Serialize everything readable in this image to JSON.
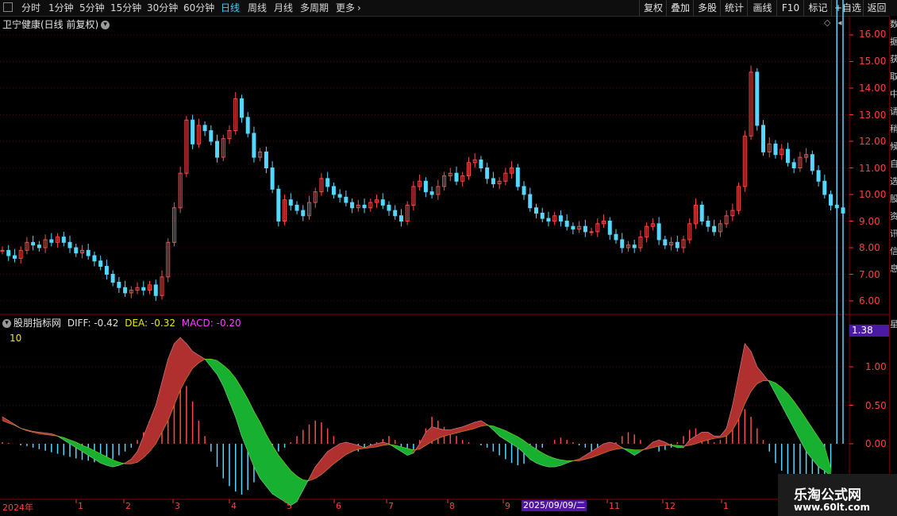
{
  "toolbar": {
    "periods": [
      "分时",
      "1分钟",
      "5分钟",
      "15分钟",
      "30分钟",
      "60分钟",
      "日线",
      "周线",
      "月线",
      "多周期",
      "更多"
    ],
    "active": "日线",
    "right_buttons": [
      "复权",
      "叠加",
      "多股",
      "统计",
      "画线",
      "F10",
      "标记",
      "+自选",
      "返回"
    ]
  },
  "main_chart": {
    "title": "卫宁健康(日线 前复权)",
    "yaxis": [
      "16.00",
      "15.00",
      "14.00",
      "13.00",
      "12.00",
      "11.00",
      "10.00",
      "9.00",
      "8.00",
      "7.00",
      "6.00"
    ]
  },
  "indicator": {
    "name": "股朋指标网",
    "diff": "DIFF: -0.42",
    "dea": "DEA: -0.32",
    "macd": "MACD: -0.20",
    "param": "10",
    "current_value": "1.38",
    "yaxis": [
      "1.00",
      "0.50",
      "0.00"
    ],
    "colors": {
      "diff": "#e0e0e0",
      "dea": "#e8e800",
      "macd": "#ff40ff"
    }
  },
  "xaxis": {
    "labels": [
      "2024年",
      "1",
      "2",
      "3",
      "4",
      "5",
      "6",
      "7",
      "8",
      "9",
      "10",
      "11",
      "12",
      "1"
    ],
    "cursor_date": "2025/09/09/二"
  },
  "right_panel": {
    "chars": [
      "数",
      "据",
      "获",
      "取",
      "中",
      "请",
      "稍",
      "候",
      "自",
      "选",
      "股",
      "资",
      "讯",
      "信",
      "息",
      "星"
    ]
  },
  "watermark": {
    "name": "乐淘公式网",
    "url": "www.60lt.com"
  },
  "chart_data": {
    "type": "candlestick",
    "ylim": [
      5.7,
      16.4
    ],
    "macd_ylim": [
      -1.1,
      1.45
    ],
    "close": [
      7.9,
      7.7,
      7.6,
      7.9,
      8.2,
      8.1,
      8.0,
      8.3,
      8.2,
      8.4,
      8.2,
      8.0,
      7.8,
      7.9,
      7.7,
      7.5,
      7.3,
      7.0,
      6.7,
      6.5,
      6.3,
      6.4,
      6.5,
      6.4,
      6.6,
      6.2,
      6.9,
      8.2,
      9.5,
      10.8,
      12.8,
      11.9,
      12.6,
      12.4,
      12.0,
      11.4,
      12.1,
      12.4,
      13.6,
      12.9,
      12.3,
      11.4,
      11.6,
      11.0,
      10.2,
      9.0,
      9.8,
      9.6,
      9.4,
      9.2,
      9.7,
      10.1,
      10.6,
      10.3,
      10.0,
      9.9,
      9.7,
      9.5,
      9.6,
      9.5,
      9.7,
      9.8,
      9.6,
      9.4,
      9.2,
      9.0,
      9.6,
      10.3,
      10.5,
      10.1,
      10.0,
      10.3,
      10.7,
      10.8,
      10.5,
      10.7,
      11.2,
      11.3,
      11.0,
      10.6,
      10.4,
      10.5,
      10.8,
      11.0,
      10.3,
      10.0,
      9.5,
      9.3,
      9.1,
      9.0,
      9.2,
      9.0,
      8.8,
      8.7,
      8.8,
      8.6,
      8.6,
      8.9,
      9.0,
      8.5,
      8.3,
      8.0,
      8.1,
      8.0,
      8.4,
      8.8,
      8.9,
      8.3,
      8.1,
      8.2,
      8.0,
      8.3,
      8.9,
      9.6,
      9.0,
      8.8,
      8.6,
      8.9,
      9.2,
      9.4,
      10.3,
      12.2,
      14.6,
      12.6,
      11.6,
      11.9,
      11.5,
      11.7,
      11.2,
      11.0,
      11.4,
      11.5,
      10.9,
      10.5,
      10.0,
      9.6,
      9.5,
      9.3
    ],
    "macd_hist": [
      0.02,
      0.01,
      0.0,
      -0.02,
      -0.03,
      -0.05,
      -0.07,
      -0.09,
      -0.11,
      -0.13,
      -0.15,
      -0.17,
      -0.19,
      -0.21,
      -0.22,
      -0.24,
      -0.25,
      -0.23,
      -0.2,
      -0.15,
      -0.1,
      -0.05,
      0.05,
      0.15,
      0.3,
      0.5,
      0.7,
      0.85,
      0.95,
      0.9,
      0.75,
      0.55,
      0.3,
      0.1,
      -0.1,
      -0.3,
      -0.45,
      -0.55,
      -0.62,
      -0.66,
      -0.6,
      -0.5,
      -0.4,
      -0.3,
      -0.2,
      -0.1,
      -0.05,
      0.02,
      0.1,
      0.18,
      0.25,
      0.3,
      0.28,
      0.2,
      0.1,
      0.0,
      -0.05,
      -0.08,
      -0.1,
      -0.06,
      -0.02,
      0.02,
      0.06,
      0.1,
      0.05,
      -0.05,
      -0.1,
      -0.12,
      0.05,
      0.2,
      0.35,
      0.3,
      0.22,
      0.15,
      0.1,
      0.05,
      0.02,
      0.0,
      -0.02,
      -0.05,
      -0.1,
      -0.15,
      -0.2,
      -0.25,
      -0.28,
      -0.26,
      -0.2,
      -0.12,
      -0.05,
      0.0,
      0.05,
      0.08,
      0.05,
      0.02,
      -0.02,
      -0.05,
      -0.1,
      -0.14,
      -0.1,
      -0.05,
      0.02,
      0.1,
      0.15,
      0.12,
      0.05,
      0.0,
      -0.05,
      -0.1,
      -0.08,
      -0.05,
      0.02,
      0.1,
      0.18,
      0.2,
      0.15,
      0.08,
      0.02,
      0.05,
      0.2,
      0.4,
      0.5,
      0.45,
      0.35,
      0.2,
      0.05,
      -0.1,
      -0.25,
      -0.35,
      -0.45,
      -0.5,
      -0.55,
      -0.55,
      -0.5,
      -0.45,
      -0.4,
      -0.35
    ],
    "diff": [
      0.35,
      0.3,
      0.25,
      0.2,
      0.18,
      0.16,
      0.15,
      0.14,
      0.13,
      0.1,
      0.05,
      0.0,
      -0.05,
      -0.1,
      -0.15,
      -0.2,
      -0.25,
      -0.28,
      -0.3,
      -0.28,
      -0.25,
      -0.2,
      -0.1,
      0.1,
      0.3,
      0.5,
      0.8,
      1.1,
      1.3,
      1.38,
      1.3,
      1.2,
      1.15,
      1.1,
      1.0,
      0.9,
      0.75,
      0.55,
      0.35,
      0.1,
      -0.1,
      -0.3,
      -0.45,
      -0.55,
      -0.65,
      -0.7,
      -0.75,
      -0.8,
      -0.75,
      -0.6,
      -0.45,
      -0.3,
      -0.2,
      -0.1,
      -0.05,
      0.0,
      0.02,
      0.0,
      -0.02,
      -0.05,
      -0.02,
      0.0,
      0.02,
      0.0,
      -0.05,
      -0.1,
      -0.15,
      -0.12,
      0.0,
      0.15,
      0.22,
      0.2,
      0.18,
      0.18,
      0.2,
      0.22,
      0.25,
      0.28,
      0.3,
      0.25,
      0.18,
      0.1,
      0.05,
      0.0,
      -0.05,
      -0.12,
      -0.2,
      -0.25,
      -0.28,
      -0.3,
      -0.3,
      -0.28,
      -0.25,
      -0.22,
      -0.2,
      -0.15,
      -0.1,
      -0.05,
      0.0,
      0.02,
      0.0,
      -0.05,
      -0.1,
      -0.15,
      -0.1,
      -0.05,
      0.02,
      0.05,
      0.02,
      -0.02,
      -0.05,
      -0.05,
      0.05,
      0.1,
      0.15,
      0.15,
      0.1,
      0.1,
      0.2,
      0.5,
      0.9,
      1.3,
      1.2,
      1.0,
      0.9,
      0.8,
      0.65,
      0.5,
      0.35,
      0.2,
      0.05,
      -0.1,
      -0.2,
      -0.3,
      -0.35,
      -0.42
    ],
    "dea": [
      0.3,
      0.27,
      0.24,
      0.2,
      0.17,
      0.15,
      0.13,
      0.12,
      0.11,
      0.1,
      0.08,
      0.05,
      0.02,
      -0.02,
      -0.05,
      -0.09,
      -0.13,
      -0.17,
      -0.21,
      -0.24,
      -0.26,
      -0.26,
      -0.24,
      -0.18,
      -0.1,
      0.0,
      0.15,
      0.3,
      0.5,
      0.7,
      0.85,
      0.98,
      1.05,
      1.1,
      1.1,
      1.08,
      1.02,
      0.95,
      0.85,
      0.72,
      0.58,
      0.42,
      0.28,
      0.12,
      -0.02,
      -0.15,
      -0.25,
      -0.35,
      -0.42,
      -0.47,
      -0.48,
      -0.45,
      -0.4,
      -0.33,
      -0.26,
      -0.2,
      -0.14,
      -0.1,
      -0.07,
      -0.06,
      -0.05,
      -0.04,
      -0.02,
      -0.01,
      -0.02,
      -0.04,
      -0.06,
      -0.08,
      -0.07,
      -0.02,
      0.03,
      0.07,
      0.1,
      0.12,
      0.14,
      0.16,
      0.18,
      0.2,
      0.23,
      0.24,
      0.23,
      0.2,
      0.17,
      0.13,
      0.09,
      0.04,
      -0.02,
      -0.07,
      -0.12,
      -0.16,
      -0.19,
      -0.21,
      -0.22,
      -0.22,
      -0.22,
      -0.2,
      -0.18,
      -0.15,
      -0.12,
      -0.09,
      -0.07,
      -0.06,
      -0.07,
      -0.08,
      -0.08,
      -0.07,
      -0.05,
      -0.03,
      -0.02,
      -0.02,
      -0.02,
      -0.03,
      -0.02,
      0.0,
      0.03,
      0.05,
      0.07,
      0.08,
      0.1,
      0.18,
      0.32,
      0.52,
      0.68,
      0.78,
      0.82,
      0.82,
      0.79,
      0.73,
      0.65,
      0.55,
      0.44,
      0.32,
      0.2,
      0.08,
      -0.04,
      -0.32
    ]
  }
}
